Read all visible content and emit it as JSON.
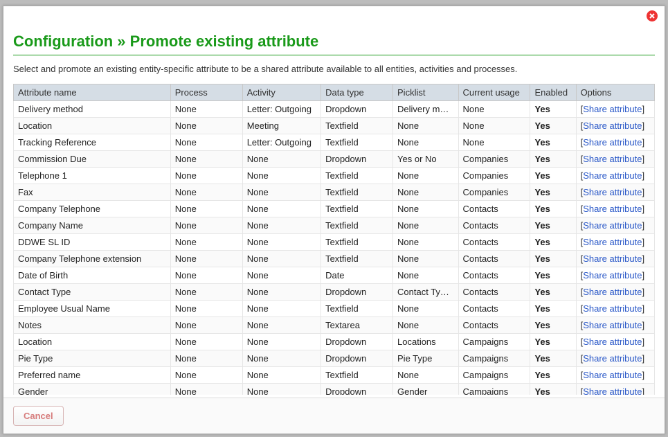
{
  "header": {
    "title_breadcrumb": "Configuration » Promote existing attribute"
  },
  "intro_text": "Select and promote an existing entity-specific attribute to be a shared attribute available to all entities, activities and processes.",
  "columns": [
    "Attribute name",
    "Process",
    "Activity",
    "Data type",
    "Picklist",
    "Current usage",
    "Enabled",
    "Options"
  ],
  "option_label": "Share attribute",
  "rows": [
    {
      "name": "Delivery method",
      "process": "None",
      "activity": "Letter: Outgoing",
      "datatype": "Dropdown",
      "picklist": "Delivery methods",
      "usage": "None",
      "enabled": "Yes"
    },
    {
      "name": "Location",
      "process": "None",
      "activity": "Meeting",
      "datatype": "Textfield",
      "picklist": "None",
      "usage": "None",
      "enabled": "Yes"
    },
    {
      "name": "Tracking Reference",
      "process": "None",
      "activity": "Letter: Outgoing",
      "datatype": "Textfield",
      "picklist": "None",
      "usage": "None",
      "enabled": "Yes"
    },
    {
      "name": "Commission Due",
      "process": "None",
      "activity": "None",
      "datatype": "Dropdown",
      "picklist": "Yes or No",
      "usage": "Companies",
      "enabled": "Yes"
    },
    {
      "name": "Telephone 1",
      "process": "None",
      "activity": "None",
      "datatype": "Textfield",
      "picklist": "None",
      "usage": "Companies",
      "enabled": "Yes"
    },
    {
      "name": "Fax",
      "process": "None",
      "activity": "None",
      "datatype": "Textfield",
      "picklist": "None",
      "usage": "Companies",
      "enabled": "Yes"
    },
    {
      "name": "Company Telephone",
      "process": "None",
      "activity": "None",
      "datatype": "Textfield",
      "picklist": "None",
      "usage": "Contacts",
      "enabled": "Yes"
    },
    {
      "name": "Company Name",
      "process": "None",
      "activity": "None",
      "datatype": "Textfield",
      "picklist": "None",
      "usage": "Contacts",
      "enabled": "Yes"
    },
    {
      "name": "DDWE SL ID",
      "process": "None",
      "activity": "None",
      "datatype": "Textfield",
      "picklist": "None",
      "usage": "Contacts",
      "enabled": "Yes"
    },
    {
      "name": "Company Telephone extension",
      "process": "None",
      "activity": "None",
      "datatype": "Textfield",
      "picklist": "None",
      "usage": "Contacts",
      "enabled": "Yes"
    },
    {
      "name": "Date of Birth",
      "process": "None",
      "activity": "None",
      "datatype": "Date",
      "picklist": "None",
      "usage": "Contacts",
      "enabled": "Yes"
    },
    {
      "name": "Contact Type",
      "process": "None",
      "activity": "None",
      "datatype": "Dropdown",
      "picklist": "Contact Types",
      "usage": "Contacts",
      "enabled": "Yes"
    },
    {
      "name": "Employee Usual Name",
      "process": "None",
      "activity": "None",
      "datatype": "Textfield",
      "picklist": "None",
      "usage": "Contacts",
      "enabled": "Yes"
    },
    {
      "name": "Notes",
      "process": "None",
      "activity": "None",
      "datatype": "Textarea",
      "picklist": "None",
      "usage": "Contacts",
      "enabled": "Yes"
    },
    {
      "name": "Location",
      "process": "None",
      "activity": "None",
      "datatype": "Dropdown",
      "picklist": "Locations",
      "usage": "Campaigns",
      "enabled": "Yes"
    },
    {
      "name": "Pie Type",
      "process": "None",
      "activity": "None",
      "datatype": "Dropdown",
      "picklist": "Pie Type",
      "usage": "Campaigns",
      "enabled": "Yes"
    },
    {
      "name": "Preferred name",
      "process": "None",
      "activity": "None",
      "datatype": "Textfield",
      "picklist": "None",
      "usage": "Campaigns",
      "enabled": "Yes"
    },
    {
      "name": "Gender",
      "process": "None",
      "activity": "None",
      "datatype": "Dropdown",
      "picklist": "Gender",
      "usage": "Campaigns",
      "enabled": "Yes"
    }
  ],
  "footer": {
    "cancel_label": "Cancel"
  }
}
